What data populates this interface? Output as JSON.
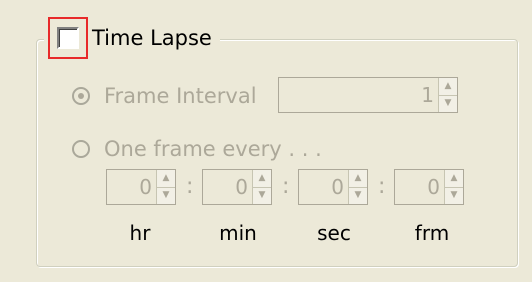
{
  "time_lapse": {
    "label": "Time Lapse",
    "checked": false
  },
  "frame_interval": {
    "label": "Frame Interval",
    "value": "1",
    "selected": true
  },
  "one_frame_every": {
    "label": "One frame every . . ."
  },
  "fields": [
    {
      "value": "0",
      "unit": "hr"
    },
    {
      "value": "0",
      "unit": "min"
    },
    {
      "value": "0",
      "unit": "sec"
    },
    {
      "value": "0",
      "unit": "frm"
    }
  ],
  "separator": ":",
  "icons": {
    "spin_up": "up-arrow-icon",
    "spin_down": "down-arrow-icon"
  }
}
